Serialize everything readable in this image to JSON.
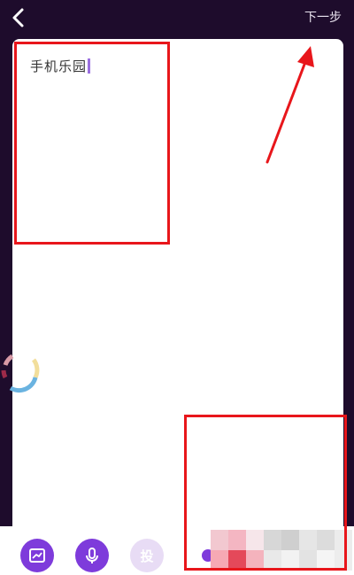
{
  "header": {
    "back_icon": "chevron-left-icon",
    "next_label": "下一步"
  },
  "editor": {
    "text": "手机乐园"
  },
  "toolbar": {
    "items": [
      {
        "icon": "image-icon"
      },
      {
        "icon": "microphone-icon"
      },
      {
        "label": "投"
      }
    ]
  },
  "colors": {
    "background": "#1e0c2c",
    "accent": "#7e3bdb",
    "annotation": "#e8161b"
  }
}
